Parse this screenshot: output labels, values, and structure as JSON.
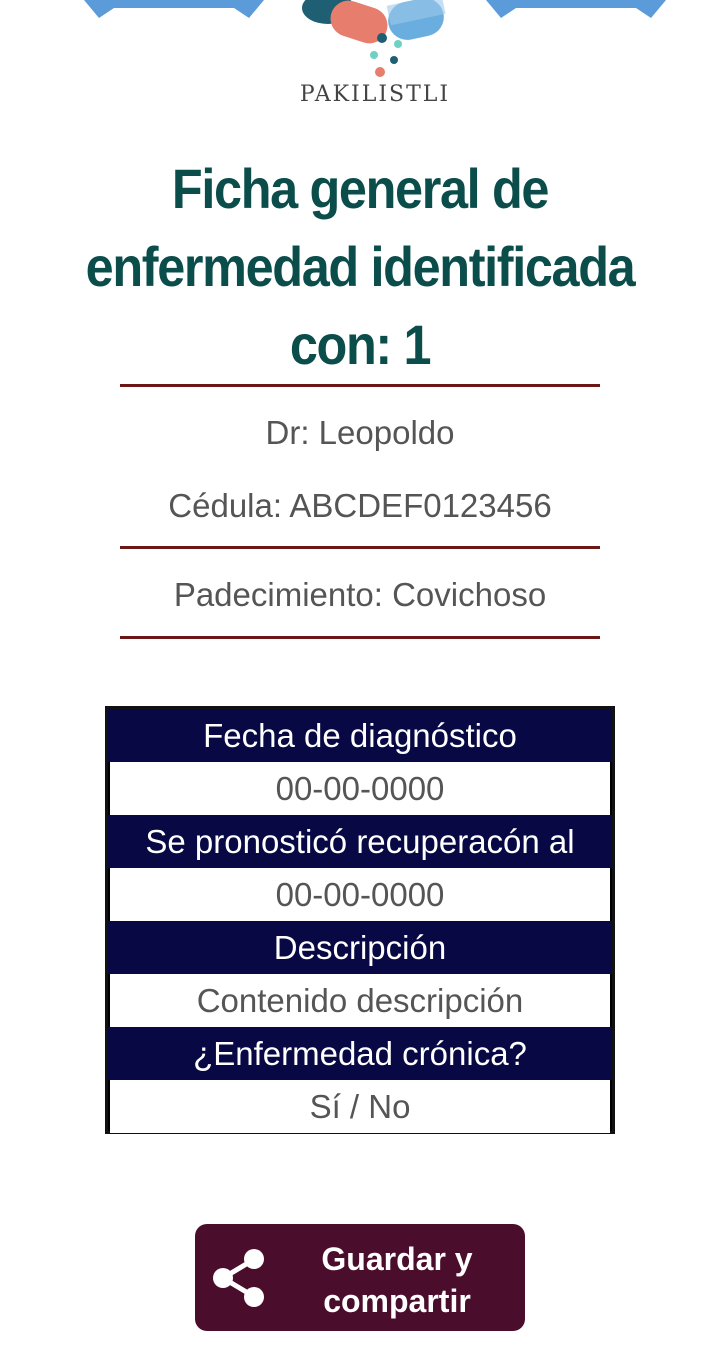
{
  "logo": {
    "text": "PAKILISTLI",
    "icon": "pills-logo-icon"
  },
  "title": "Ficha general de enfermedad identificada con: 1",
  "doctor": "Dr: Leopoldo",
  "cedula": "Cédula: ABCDEF0123456",
  "padecimiento": "Padecimiento: Covichoso",
  "table": {
    "rows": [
      {
        "header": "Fecha de diagnóstico",
        "value": "00-00-0000"
      },
      {
        "header": " Se pronosticó recuperacón al",
        "value": "00-00-0000"
      },
      {
        "header": "Descripción",
        "value": "Contenido descripción"
      },
      {
        "header": "¿Enfermedad crónica?",
        "value": "Sí / No"
      }
    ]
  },
  "save_button": {
    "label": "Guardar y compartir",
    "icon": "share-icon"
  },
  "colors": {
    "title": "#0a4d4a",
    "rule": "#6b1717",
    "table_header": "#080944",
    "button": "#4a0d2b"
  }
}
